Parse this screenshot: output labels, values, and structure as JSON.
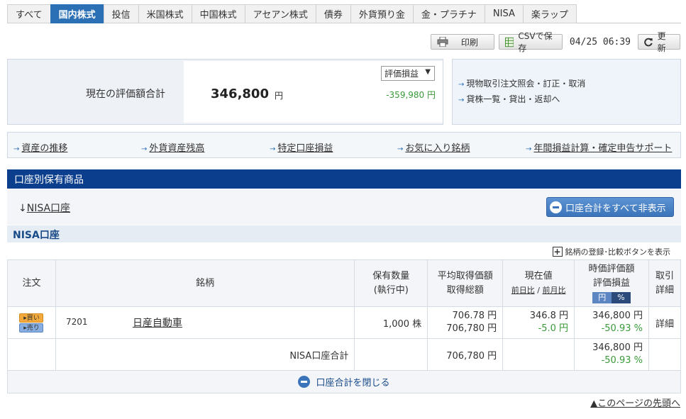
{
  "tabs": [
    "すべて",
    "国内株式",
    "投信",
    "米国株式",
    "中国株式",
    "アセアン株式",
    "債券",
    "外貨預り金",
    "金・プラチナ",
    "NISA",
    "楽ラップ"
  ],
  "active_tab": "国内株式",
  "toolbar": {
    "print_label": "印刷",
    "csv_label": "CSVで保存",
    "timestamp": "04/25 06:39",
    "refresh_label": "更新"
  },
  "summary": {
    "label": "現在の評価額合計",
    "amount": "346,800",
    "unit": "円",
    "select_value": "評価損益",
    "profit_loss": "-359,980 円"
  },
  "side_links": [
    "現物取引注文照会・訂正・取消",
    "貸株一覧・貸出・返却へ"
  ],
  "quick_links": [
    "資産の推移",
    "外貨資産残高",
    "特定口座損益",
    "お気に入り銘柄",
    "年間損益計算・確定申告サポート"
  ],
  "section_title": "口座別保有商品",
  "account_link": "NISA口座",
  "hide_all_button": "口座合計をすべて非表示",
  "nisa_title": "NISA口座",
  "compare_note": "銘柄の登録･比較ボタンを表示",
  "table": {
    "headers": {
      "order": "注文",
      "name": "銘柄",
      "qty_line1": "保有数量",
      "qty_line2": "(執行中)",
      "avg_line1": "平均取得価額",
      "avg_line2": "取得総額",
      "price_line1": "現在値",
      "price_line2a": "前日比",
      "price_sep": " / ",
      "price_line2b": "前月比",
      "val_line1": "時価評価額",
      "val_line2": "評価損益",
      "toggle_yen": "円",
      "toggle_pct": "%",
      "detail_line1": "取引",
      "detail_line2": "詳細"
    },
    "row": {
      "buy": "買い",
      "sell": "売り",
      "code": "7201",
      "name": "日産自動車",
      "qty": "1,000",
      "qty_unit": "株",
      "avg_price": "706.78 円",
      "total_cost": "706,780 円",
      "price": "346.8 円",
      "change": "-5.0 円",
      "value": "346,800 円",
      "pl_pct": "-50.93 %",
      "detail": "詳細"
    },
    "total": {
      "label": "NISA口座合計",
      "total_cost": "706,780 円",
      "value": "346,800 円",
      "pl_pct": "-50.93 %"
    }
  },
  "close_label": "口座合計を閉じる",
  "pagetop_label": "▲このページの先頭へ"
}
